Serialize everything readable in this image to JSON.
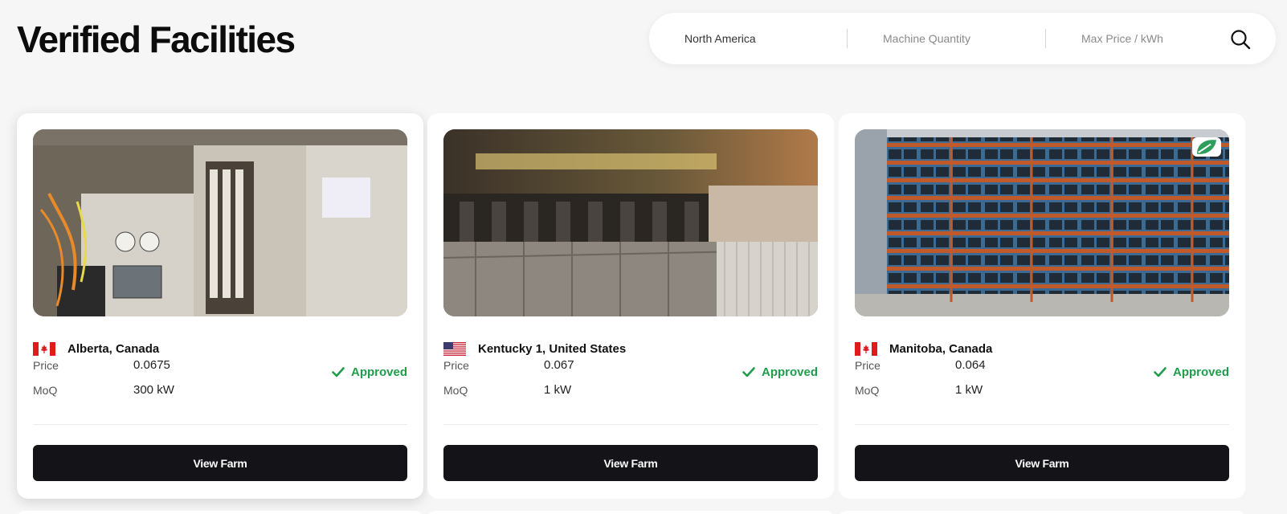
{
  "header": {
    "title": "Verified Facilities"
  },
  "search": {
    "region": "North America",
    "quantity_placeholder": "Machine Quantity",
    "price_placeholder": "Max Price / kWh",
    "icon": "search-icon"
  },
  "labels": {
    "price": "Price",
    "moq": "MoQ"
  },
  "cards": [
    {
      "location": "Alberta, Canada",
      "flag": "canada-flag-icon",
      "price": "0.0675",
      "moq": "300 kW",
      "status": "Approved",
      "button": "View Farm",
      "eco_badge": false
    },
    {
      "location": "Kentucky 1, United States",
      "flag": "us-flag-icon",
      "price": "0.067",
      "moq": "1 kW",
      "status": "Approved",
      "button": "View Farm",
      "eco_badge": false
    },
    {
      "location": "Manitoba, Canada",
      "flag": "canada-flag-icon",
      "price": "0.064",
      "moq": "1 kW",
      "status": "Approved",
      "button": "View Farm",
      "eco_badge": true
    }
  ],
  "colors": {
    "approved": "#1e9e4a",
    "button": "#141418",
    "canada_red": "#e01b1b",
    "leaf": "#2e9e5b"
  }
}
